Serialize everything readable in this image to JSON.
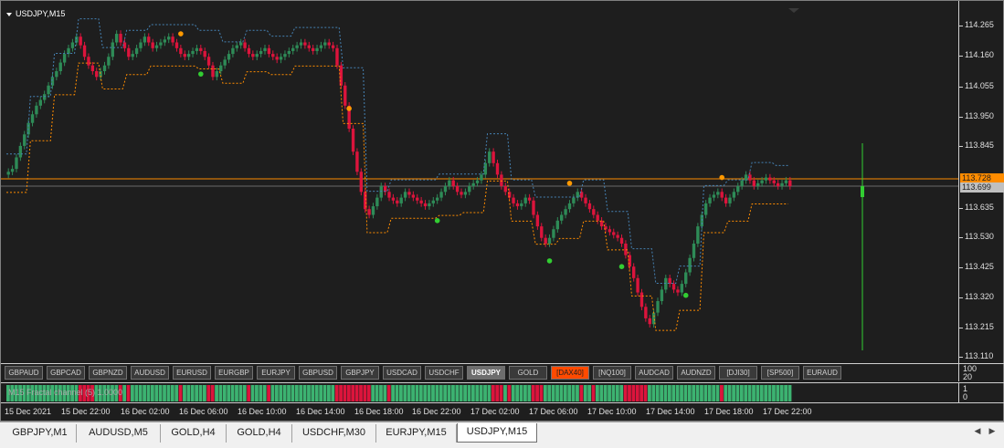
{
  "window": {
    "title": "USDJPY,M15"
  },
  "price_scale": {
    "ticks": [
      "114.265",
      "114.160",
      "114.055",
      "113.950",
      "113.845",
      "113.635",
      "113.530",
      "113.425",
      "113.320",
      "113.215",
      "113.110"
    ],
    "bid_tag": "113.728",
    "last_tag": "113.699",
    "bid_color": "#ff8c00",
    "last_color": "#808080"
  },
  "symbol_buttons": [
    "GBPAUD",
    "GBPCAD",
    "GBPNZD",
    "AUDUSD",
    "EURUSD",
    "EURGBP",
    "EURJPY",
    "GBPUSD",
    "GBPJPY",
    "USDCAD",
    "USDCHF",
    "USDJPY",
    "GOLD",
    "[DAX40]",
    "[NQ100]",
    "AUDCAD",
    "AUDNZD",
    "[DJI30]",
    "[SP500]",
    "EURAUD"
  ],
  "active_symbol": "USDJPY",
  "highlight_symbol": "[DAX40]",
  "sub_scale_1": {
    "top": "100",
    "bottom": "20"
  },
  "sub_scale_2": {
    "top": "1",
    "bottom": "0"
  },
  "indicator": {
    "label": "M15 Fractal channel (5) 1.0000"
  },
  "time_axis": [
    "15 Dec 2021",
    "15 Dec 22:00",
    "16 Dec 02:00",
    "16 Dec 06:00",
    "16 Dec 10:00",
    "16 Dec 14:00",
    "16 Dec 18:00",
    "16 Dec 22:00",
    "17 Dec 02:00",
    "17 Dec 06:00",
    "17 Dec 10:00",
    "17 Dec 14:00",
    "17 Dec 18:00",
    "17 Dec 22:00"
  ],
  "tabs": [
    "GBPJPY,M1",
    "AUDUSD,M5",
    "GOLD,H4",
    "GOLD,H4",
    "USDCHF,M30",
    "EURJPY,M15",
    "USDJPY,M15"
  ],
  "active_tab": "USDJPY,M15",
  "colors": {
    "bull": "#2e8b57",
    "bear": "#dc143c",
    "upper_channel": "#4682b4",
    "lower_channel": "#ff8c00",
    "fractal_up": "#ff9900",
    "fractal_down": "#32cd32",
    "bid_line": "#ff8c00"
  },
  "chart_data": {
    "type": "candlestick",
    "symbol": "USDJPY",
    "timeframe": "M15",
    "ylim": [
      113.1,
      114.3
    ],
    "x_start": "15 Dec 2021 18:00",
    "bars_per_hour": 4,
    "closes": [
      113.75,
      113.76,
      113.8,
      113.84,
      113.88,
      113.92,
      113.95,
      113.98,
      114.0,
      114.02,
      114.05,
      114.08,
      114.1,
      114.13,
      114.16,
      114.18,
      114.2,
      114.22,
      114.19,
      114.15,
      114.12,
      114.1,
      114.08,
      114.1,
      114.12,
      114.15,
      114.2,
      114.23,
      114.2,
      114.18,
      114.15,
      114.16,
      114.18,
      114.2,
      114.22,
      114.2,
      114.18,
      114.19,
      114.2,
      114.21,
      114.22,
      114.2,
      114.18,
      114.16,
      114.15,
      114.16,
      114.17,
      114.18,
      114.17,
      114.15,
      114.12,
      114.08,
      114.1,
      114.12,
      114.14,
      114.16,
      114.18,
      114.19,
      114.2,
      114.18,
      114.16,
      114.15,
      114.16,
      114.17,
      114.18,
      114.16,
      114.15,
      114.14,
      114.15,
      114.16,
      114.17,
      114.18,
      114.19,
      114.2,
      114.19,
      114.18,
      114.17,
      114.18,
      114.19,
      114.2,
      114.19,
      114.18,
      114.12,
      114.05,
      113.98,
      113.9,
      113.82,
      113.75,
      113.68,
      113.62,
      113.6,
      113.63,
      113.66,
      113.7,
      113.68,
      113.66,
      113.65,
      113.64,
      113.66,
      113.68,
      113.67,
      113.66,
      113.65,
      113.64,
      113.63,
      113.64,
      113.65,
      113.66,
      113.68,
      113.7,
      113.72,
      113.7,
      113.68,
      113.67,
      113.68,
      113.7,
      113.71,
      113.72,
      113.74,
      113.78,
      113.82,
      113.78,
      113.74,
      113.7,
      113.68,
      113.66,
      113.64,
      113.63,
      113.64,
      113.66,
      113.65,
      113.6,
      113.56,
      113.52,
      113.5,
      113.52,
      113.55,
      113.58,
      113.6,
      113.62,
      113.64,
      113.66,
      113.68,
      113.66,
      113.64,
      113.62,
      113.6,
      113.58,
      113.56,
      113.55,
      113.54,
      113.53,
      113.52,
      113.5,
      113.46,
      113.42,
      113.38,
      113.33,
      113.28,
      113.24,
      113.22,
      113.26,
      113.3,
      113.34,
      113.38,
      113.36,
      113.34,
      113.33,
      113.36,
      113.4,
      113.45,
      113.5,
      113.56,
      113.6,
      113.64,
      113.66,
      113.67,
      113.68,
      113.66,
      113.64,
      113.66,
      113.68,
      113.7,
      113.72,
      113.74,
      113.72,
      113.7,
      113.71,
      113.72,
      113.73,
      113.72,
      113.71,
      113.7,
      113.71,
      113.72,
      113.7
    ]
  }
}
